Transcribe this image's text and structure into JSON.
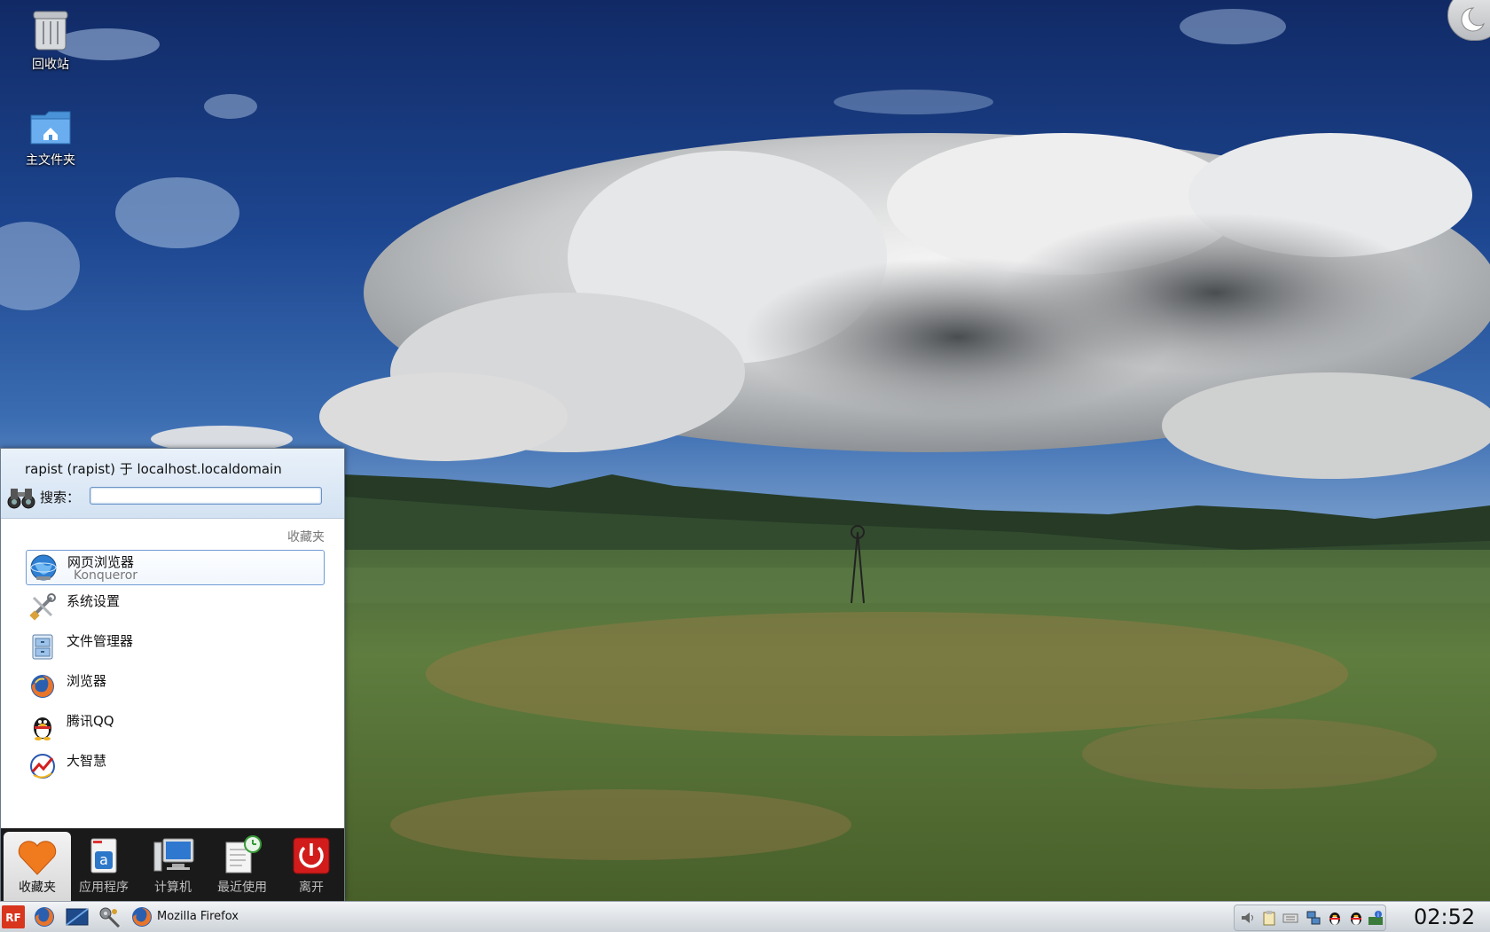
{
  "desktop": {
    "icons": [
      {
        "label": "回收站",
        "icon": "trash-icon"
      },
      {
        "label": "主文件夹",
        "icon": "home-folder-icon"
      }
    ]
  },
  "kickoff": {
    "user_line": "rapist (rapist) 于 localhost.localdomain",
    "search_label": "搜索：",
    "search_value": "",
    "section_title": "收藏夹",
    "favorites": [
      {
        "title": "网页浏览器",
        "subtitle": "Konqueror",
        "icon": "globe-icon",
        "selected": true
      },
      {
        "title": "系统设置",
        "subtitle": "",
        "icon": "tools-icon",
        "selected": false
      },
      {
        "title": "文件管理器",
        "subtitle": "",
        "icon": "file-cabinet-icon",
        "selected": false
      },
      {
        "title": "浏览器",
        "subtitle": "",
        "icon": "firefox-icon",
        "selected": false
      },
      {
        "title": "腾讯QQ",
        "subtitle": "",
        "icon": "qq-penguin-icon",
        "selected": false
      },
      {
        "title": "大智慧",
        "subtitle": "",
        "icon": "dzh-chart-icon",
        "selected": false
      }
    ],
    "tabs": [
      {
        "label": "收藏夹",
        "icon": "heart-icon",
        "active": true
      },
      {
        "label": "应用程序",
        "icon": "applications-icon",
        "active": false
      },
      {
        "label": "计算机",
        "icon": "computer-icon",
        "active": false
      },
      {
        "label": "最近使用",
        "icon": "recent-docs-icon",
        "active": false
      },
      {
        "label": "离开",
        "icon": "power-icon",
        "active": false
      }
    ]
  },
  "taskbar": {
    "launchers": [
      "red-flag-kmenu-icon",
      "firefox-icon",
      "desktop-show-icon",
      "system-tools-icon"
    ],
    "task": {
      "label": "Mozilla Firefox",
      "icon": "firefox-icon"
    },
    "tray": [
      "volume-icon",
      "clipboard-icon",
      "keyboard-icon",
      "network-icon",
      "qq-penguin-icon",
      "qq-penguin-icon",
      "info-icon"
    ],
    "clock": "02:52"
  },
  "colors": {
    "sky_top": "#17316e",
    "selection_border": "#6f9bd4",
    "tab_bar": "#1a1a1a"
  }
}
